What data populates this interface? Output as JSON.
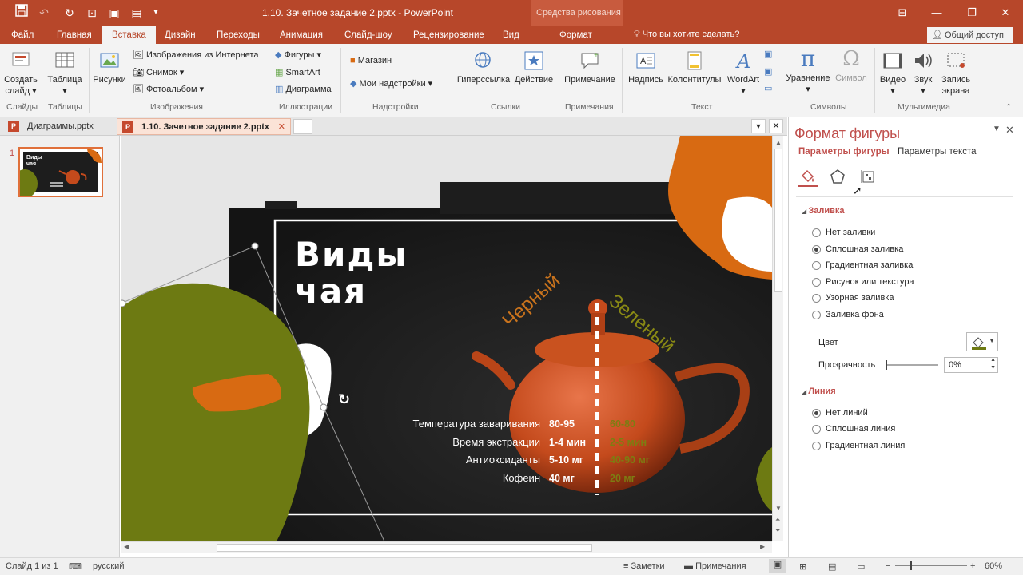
{
  "window": {
    "title": "1.10. Зачетное задание 2.pptx - PowerPoint",
    "contextual_header": "Средства рисования",
    "accent": "#b7472a"
  },
  "qat": {
    "save_icon": "save-icon",
    "undo_icon": "undo-icon",
    "repeat_icon": "repeat-icon",
    "more_icon": "customize-qat-icon"
  },
  "tabs": [
    "Файл",
    "Главная",
    "Вставка",
    "Дизайн",
    "Переходы",
    "Анимация",
    "Слайд-шоу",
    "Рецензирование",
    "Вид",
    "Формат"
  ],
  "active_tab": "Вставка",
  "tell_me": "Что вы хотите сделать?",
  "share": "Общий доступ",
  "ribbon": {
    "slides": {
      "new_slide": "Создать",
      "new_slide2": "слайд",
      "group": "Слайды"
    },
    "tables": {
      "table": "Таблица",
      "group": "Таблицы"
    },
    "images": {
      "pictures": "Рисунки",
      "online": "Изображения из Интернета",
      "screenshot": "Снимок",
      "album": "Фотоальбом",
      "group": "Изображения"
    },
    "illustrations": {
      "shapes": "Фигуры",
      "smartart": "SmartArt",
      "chart": "Диаграмма",
      "group": "Иллюстрации"
    },
    "addins": {
      "store": "Магазин",
      "my": "Мои надстройки",
      "group": "Надстройки"
    },
    "links": {
      "hyperlink": "Гиперссылка",
      "action": "Действие",
      "group": "Ссылки"
    },
    "comments": {
      "comment": "Примечание",
      "group": "Примечания"
    },
    "text": {
      "textbox": "Надпись",
      "header": "Колонтитулы",
      "wordart": "WordArt",
      "group": "Текст"
    },
    "symbols": {
      "equation": "Уравнение",
      "symbol": "Символ",
      "group": "Символы"
    },
    "media": {
      "video": "Видео",
      "audio": "Звук",
      "record": "Запись",
      "record2": "экрана",
      "group": "Мультимедиа"
    }
  },
  "doc_tabs": [
    "Диаграммы.pptx",
    "1.10. Зачетное задание 2.pptx"
  ],
  "thumbnail": {
    "number": "1",
    "title": "Виды чая"
  },
  "slide": {
    "title_line1": "Виды",
    "title_line2": "чая",
    "arc_left": "Черный",
    "arc_right": "Зеленый",
    "rows": [
      {
        "label": "Температура заваривания",
        "black": "80-95",
        "green": "60-80"
      },
      {
        "label": "Время экстракции",
        "black": "1-4 мин",
        "green": "2-5 мин"
      },
      {
        "label": "Антиоксиданты",
        "black": "5-10 мг",
        "green": "40-90 мг"
      },
      {
        "label": "Кофеин",
        "black": "40 мг",
        "green": "20 мг"
      }
    ],
    "colors": {
      "olive": "#6d7a12",
      "orange": "#d86a12",
      "dark": "#1d1d1d",
      "teapot": "#c44a1c"
    }
  },
  "format_pane": {
    "title": "Формат фигуры",
    "tab_shape": "Параметры фигуры",
    "tab_text": "Параметры текста",
    "fill": {
      "header": "Заливка",
      "options": [
        "Нет заливки",
        "Сплошная заливка",
        "Градиентная заливка",
        "Рисунок или текстура",
        "Узорная заливка",
        "Заливка фона"
      ],
      "selected": "Сплошная заливка",
      "color_label": "Цвет",
      "transparency_label": "Прозрачность",
      "transparency_value": "0%"
    },
    "line": {
      "header": "Линия",
      "options": [
        "Нет линий",
        "Сплошная линия",
        "Градиентная линия"
      ],
      "selected": "Нет линий"
    }
  },
  "status": {
    "slide": "Слайд 1 из 1",
    "lang": "русский",
    "notes": "Заметки",
    "comments": "Примечания",
    "zoom": "60%"
  }
}
